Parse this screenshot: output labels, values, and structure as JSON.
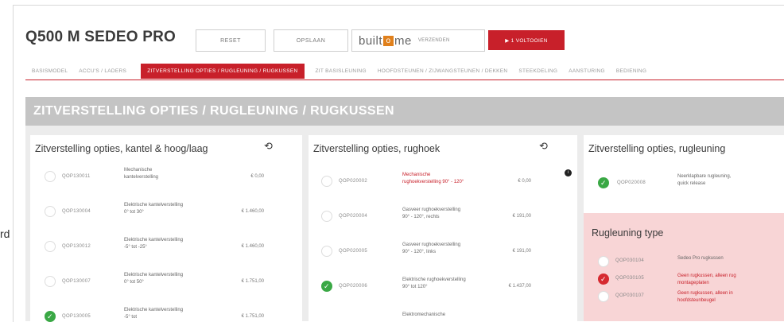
{
  "side_text": "rd",
  "header": {
    "title": "Q500 M SEDEO PRO",
    "reset_label": "RESET",
    "save_label": "OPSLAAN",
    "builtome": {
      "prefix": "built",
      "o": "o",
      "suffix": "me",
      "send": "VERZENDEN"
    },
    "red_label": "▶ 1 VOLTOOIEN"
  },
  "tabs": [
    "BASISMODEL",
    "ACCU'S / LADERS",
    "ZITVERSTELLING OPTIES / RUGLEUNING / RUGKUSSEN",
    "ZIT BASISLEUNING",
    "HOOFDSTEUNEN / ZIJWANGSTEUNEN / DEKKEN",
    "STEEKDELING",
    "AANSTURING",
    "BEDIENING"
  ],
  "active_tab": 2,
  "section_title": "ZITVERSTELLING OPTIES / RUGLEUNING / RUGKUSSEN",
  "cards": [
    {
      "title": "Zitverstelling opties, kantel & hoog/laag",
      "rows": [
        {
          "code": "QOP130011",
          "desc": "Mechanische kantelverstelling",
          "price": "€ 0,00",
          "state": "empty",
          "desc_color": "normal"
        },
        {
          "code": "QOP130004",
          "desc": "Elektrische kantelverstelling 0° tot 30°",
          "price": "€ 1.460,00",
          "state": "empty",
          "desc_color": "normal"
        },
        {
          "code": "QOP130012",
          "desc": "Elektrische kantelverstelling -5° tot -25°",
          "price": "€ 1.460,00",
          "state": "empty",
          "desc_color": "normal"
        },
        {
          "code": "QOP130007",
          "desc": "Elektrische kantelverstelling 0° tot 50°",
          "price": "€ 1.751,00",
          "state": "empty",
          "desc_color": "normal"
        },
        {
          "code": "QOP130005",
          "desc": "Elektrische kantelverstelling -5° tot",
          "price": "€ 1.751,00",
          "state": "green",
          "desc_color": "normal"
        }
      ]
    },
    {
      "title": "Zitverstelling opties, rughoek",
      "rows": [
        {
          "code": "QOP020002",
          "desc": "Mechanische rughoekverstelling 90° - 120°",
          "price": "€ 0,00",
          "state": "empty",
          "desc_color": "red"
        },
        {
          "code": "QOP020004",
          "desc": "Gasveer rughoekverstelling 90° - 120°, rechts",
          "price": "€ 191,00",
          "state": "empty",
          "desc_color": "normal"
        },
        {
          "code": "QOP020005",
          "desc": "Gasveer rughoekverstelling 90° - 120°, links",
          "price": "€ 191,00",
          "state": "empty",
          "desc_color": "normal"
        },
        {
          "code": "QOP020006",
          "desc": "Elektrische rughoekverstelling 90° tot 120°",
          "price": "€ 1.437,00",
          "state": "green",
          "desc_color": "normal"
        },
        {
          "code": "",
          "desc": "Elektromechanische",
          "price": "",
          "state": "none",
          "desc_color": "normal"
        }
      ]
    },
    {
      "title": "Zitverstelling opties, rugleuning",
      "rows": [
        {
          "code": "QOP020008",
          "desc": "Neerklapbare rugleuning, quick release",
          "price": "",
          "state": "green",
          "desc_color": "normal"
        }
      ],
      "subsection": {
        "title": "Rugleuning type",
        "rows": [
          {
            "code": "QOP030104",
            "desc": "Sedeo Pro rugkussen",
            "state": "empty",
            "desc_color": "normal"
          },
          {
            "code": "QOP030105",
            "desc": "Geen rugkussen, alleen rug montageplaten",
            "state": "red",
            "desc_color": "red"
          },
          {
            "code": "QOP030107",
            "desc": "Geen rugkussen, alleen in hoofdsteunbeugel",
            "state": "empty",
            "desc_color": "red"
          }
        ]
      }
    }
  ],
  "icons": {
    "refresh": "refresh-icon",
    "info": "info-icon",
    "check": "check-icon"
  },
  "colors": {
    "accent": "#c8202a",
    "green": "#3aa845",
    "pink": "#f8d5d6",
    "section": "#c4c4c4"
  }
}
